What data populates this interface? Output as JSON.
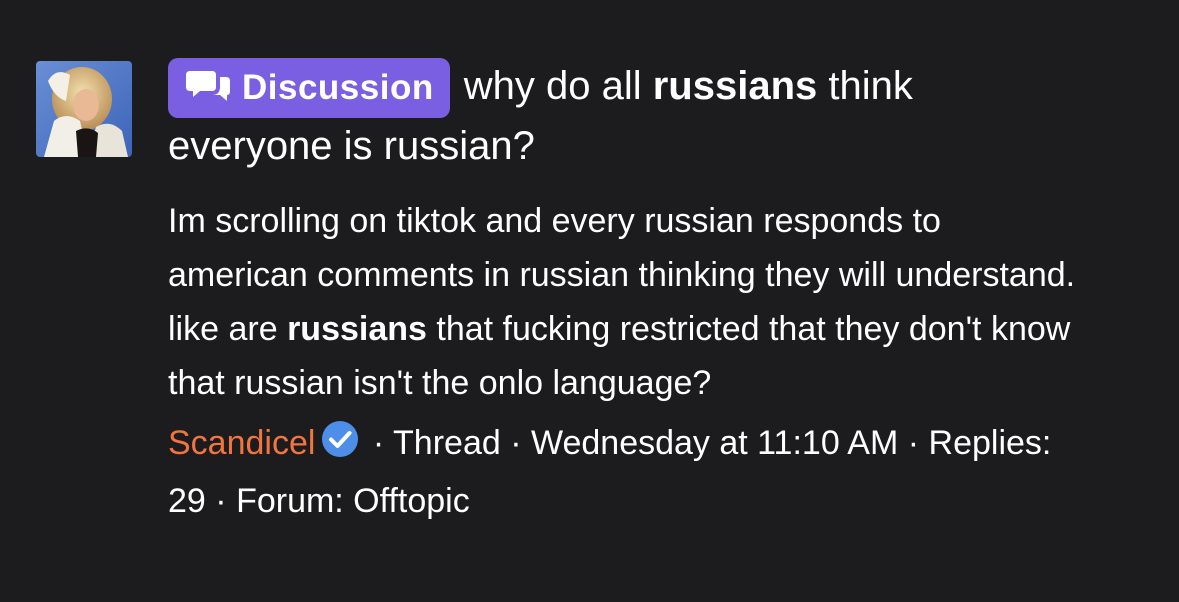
{
  "result": {
    "badge": {
      "icon": "chat-bubbles-icon",
      "label": "Discussion",
      "color": "#7b5fe3"
    },
    "title": {
      "pre": "why do all",
      "highlight": "russians",
      "post": "think everyone is russian?"
    },
    "snippet": {
      "part1": "Im scrolling on tiktok and every russian responds to american comments in russian thinking they will understand. like are",
      "highlight": "russians",
      "part2": "that fucking restricted that they don't know that russian isn't the onlo language?"
    },
    "meta": {
      "author": "Scandicel",
      "author_color": "#f0753f",
      "verified_icon": "verified-check-icon",
      "type": "· Thread ·",
      "date": "Wednesday at 11:10 AM",
      "sep": "·",
      "replies": "Replies: 29",
      "forum_sep": "·",
      "forum": "Forum: Offtopic"
    },
    "avatar": {
      "icon": "user-avatar-image"
    }
  }
}
